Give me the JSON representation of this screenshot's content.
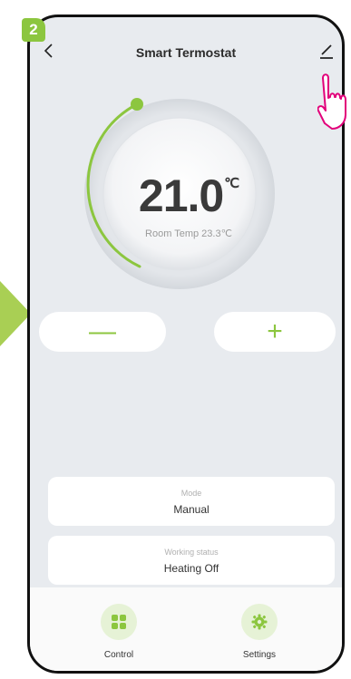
{
  "step_badge": "2",
  "header": {
    "title": "Smart Termostat",
    "back_icon": "chevron-left-icon",
    "edit_icon": "pencil-icon"
  },
  "dial": {
    "set_temperature": "21.0",
    "unit": "℃",
    "room_temp_text": "Room Temp 23.3℃",
    "accent_color": "#8cc63f"
  },
  "controls": {
    "minus_label": "—",
    "plus_label": "+"
  },
  "cards": {
    "mode": {
      "label": "Mode",
      "value": "Manual"
    },
    "working_status": {
      "label": "Working status",
      "value": "Heating Off"
    }
  },
  "bottom_nav": {
    "items": [
      {
        "label": "Control",
        "icon": "grid-icon"
      },
      {
        "label": "Settings",
        "icon": "gear-icon"
      }
    ]
  },
  "annotation": {
    "pointer_icon": "hand-pointer-icon",
    "arrow_color": "#a9cf54",
    "badge_color": "#8cc63f"
  }
}
